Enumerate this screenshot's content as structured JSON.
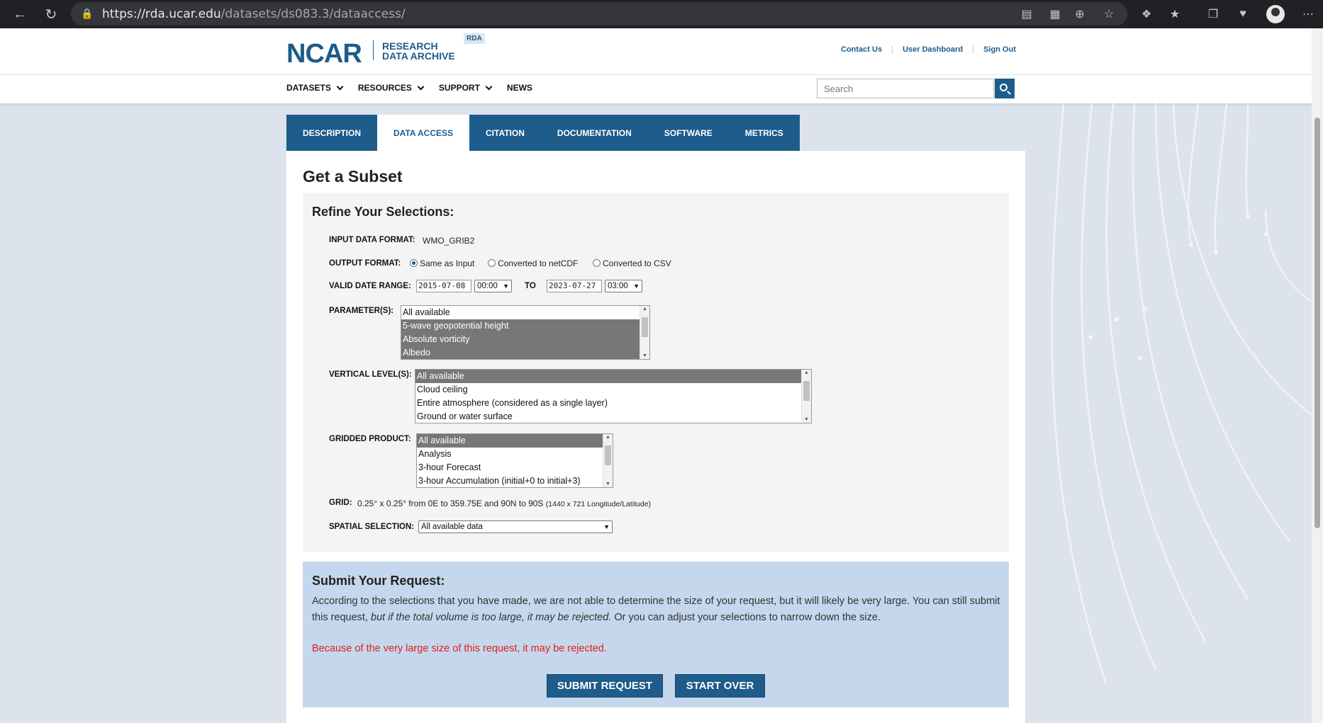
{
  "browser": {
    "url_host": "https://rda.ucar.edu",
    "url_path": "/datasets/ds083.3/dataaccess/"
  },
  "header": {
    "logo_main": "NCAR",
    "logo_line1": "RESEARCH",
    "logo_line2": "DATA ARCHIVE",
    "badge": "RDA",
    "top_links": [
      "Contact Us",
      "User Dashboard",
      "Sign Out"
    ]
  },
  "nav": {
    "items": [
      "DATASETS",
      "RESOURCES",
      "SUPPORT",
      "NEWS"
    ],
    "search_placeholder": "Search"
  },
  "tabs": [
    "DESCRIPTION",
    "DATA ACCESS",
    "CITATION",
    "DOCUMENTATION",
    "SOFTWARE",
    "METRICS"
  ],
  "page_title": "Get a Subset",
  "refine": {
    "heading": "Refine Your Selections:",
    "input_format_label": "INPUT DATA FORMAT:",
    "input_format_value": "WMO_GRIB2",
    "output_format_label": "OUTPUT FORMAT:",
    "output_options": [
      "Same as Input",
      "Converted to netCDF",
      "Converted to CSV"
    ],
    "date_range_label": "VALID DATE RANGE:",
    "start_date": "2015-07-08",
    "start_time": "00:00",
    "to_label": "TO",
    "end_date": "2023-07-27",
    "end_time": "03:00",
    "parameters_label": "PARAMETER(S):",
    "parameters": [
      "All available",
      "5-wave geopotential height",
      "Absolute vorticity",
      "Albedo"
    ],
    "vertical_label": "VERTICAL LEVEL(S):",
    "vertical_levels": [
      "All available",
      "Cloud ceiling",
      "Entire atmosphere (considered as a single layer)",
      "Ground or water surface"
    ],
    "gridded_label": "GRIDDED PRODUCT:",
    "gridded_products": [
      "All available",
      "Analysis",
      "3-hour Forecast",
      "3-hour Accumulation (initial+0 to initial+3)"
    ],
    "grid_label": "GRID:",
    "grid_value": "0.25° x 0.25° from 0E to 359.75E and 90N to 90S",
    "grid_small": "(1440 x 721 Longitude/Latitude)",
    "spatial_label": "SPATIAL SELECTION:",
    "spatial_value": "All available data"
  },
  "submit": {
    "heading": "Submit Your Request:",
    "text_a": "According to the selections that you have made, we are not able to determine the size of your request, but it will likely be very large. You can still submit this request, ",
    "text_em": "but if the total volume is too large, it may be rejected.",
    "text_b": " Or you can adjust your selections to narrow down the size.",
    "warning": "Because of the very large size of this request, it may be rejected.",
    "submit_btn": "SUBMIT REQUEST",
    "start_over_btn": "START OVER"
  }
}
